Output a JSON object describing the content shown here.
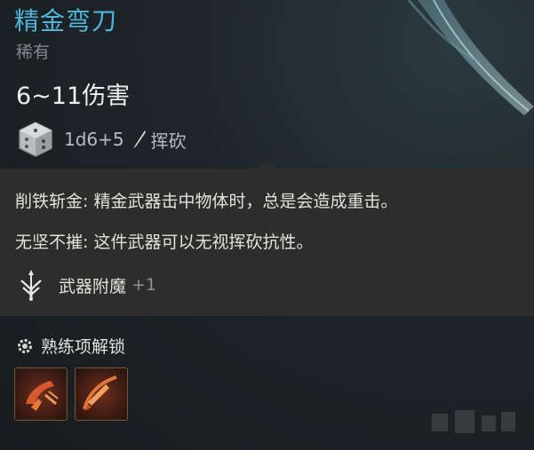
{
  "item": {
    "name": "精金弯刀",
    "rarity": "稀有",
    "damage": "6~11伤害",
    "dice_formula": "1d6+5",
    "damage_type": "挥砍",
    "dice_icon": "dice-icon",
    "damage_type_icon": "slash-icon"
  },
  "effects": {
    "line1": "削铁斩金: 精金武器击中物体时，总是会造成重击。",
    "line2": "无坚不摧: 这件武器可以无视挥砍抗性。",
    "enchant_label": "武器附魔",
    "enchant_bonus": "+1",
    "enchant_icon": "sword-enchant-icon"
  },
  "proficiency": {
    "header": "熟练项解锁",
    "header_icon": "gear-icon",
    "skills": [
      {
        "icon": "lacerate-skill-icon"
      },
      {
        "icon": "sword-slash-skill-icon"
      }
    ]
  },
  "colors": {
    "title": "#4eb4d9",
    "rarity": "#7f898d",
    "text": "#e3e1db",
    "muted": "#8d918f",
    "panel": "#2c2d2c"
  }
}
